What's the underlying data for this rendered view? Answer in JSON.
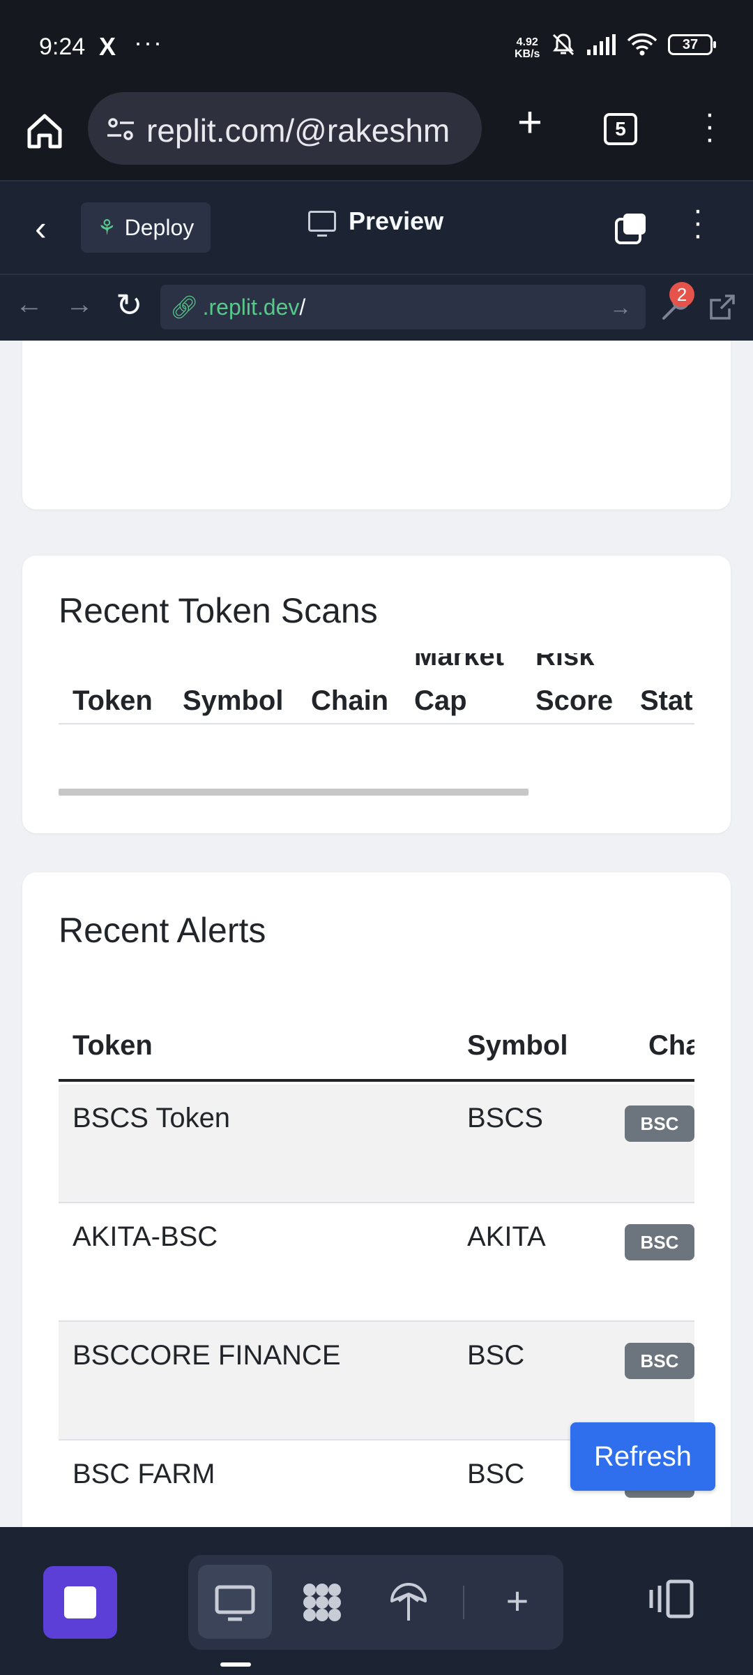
{
  "status_bar": {
    "time": "9:24",
    "app_icon": "X",
    "more": "···",
    "net_speed_value": "4.92",
    "net_speed_unit": "KB/s",
    "battery": "37"
  },
  "browser": {
    "url": "replit.com/@rakeshm",
    "tab_count": "5"
  },
  "replit_header": {
    "deploy_label": "Deploy",
    "preview_label": "Preview"
  },
  "webview": {
    "url_domain": ".replit.dev",
    "url_path": "/",
    "devtools_badge": "2"
  },
  "scans_card": {
    "title": "Recent Token Scans",
    "columns": [
      "Token",
      "Symbol",
      "Chain",
      "Market",
      "Cap",
      "Risk",
      "Score",
      "Stat"
    ]
  },
  "alerts_card": {
    "title": "Recent Alerts",
    "columns": [
      "Token",
      "Symbol",
      "Chair"
    ],
    "rows": [
      {
        "token": "BSCS Token",
        "symbol": "BSCS",
        "chain": "BSC"
      },
      {
        "token": "AKITA-BSC",
        "symbol": "AKITA",
        "chain": "BSC"
      },
      {
        "token": "BSCCORE FINANCE",
        "symbol": "BSC",
        "chain": "BSC"
      },
      {
        "token": "BSC FARM",
        "symbol": "BSC",
        "chain": "BSC"
      }
    ]
  },
  "refresh_label": "Refresh",
  "colors": {
    "primary_button": "#2f6fed",
    "badge_secondary": "#6c757d",
    "replit_dark": "#1c2333",
    "stop_button": "#5b3fd6",
    "link_green": "#58c88b"
  }
}
